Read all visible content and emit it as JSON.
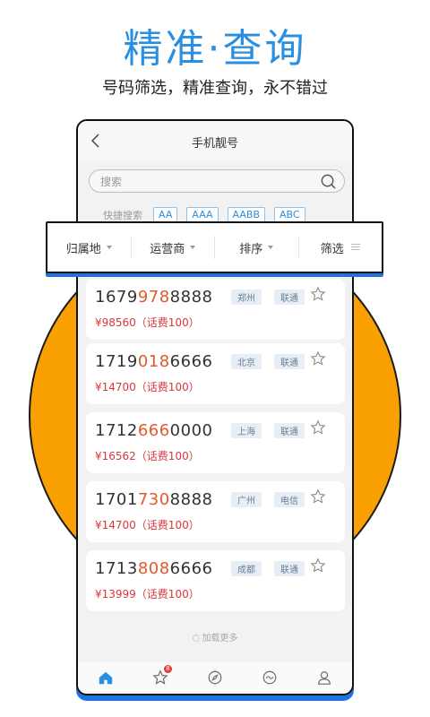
{
  "banner": {
    "headline": "精准·查询",
    "subline": "号码筛选，精准查询，永不错过"
  },
  "app": {
    "title": "手机靓号",
    "search": {
      "placeholder": "搜索"
    },
    "quick_search": {
      "label": "快捷搜索",
      "tags": [
        "AA",
        "AAA",
        "AABB",
        "ABC"
      ]
    },
    "filters": [
      {
        "label": "归属地"
      },
      {
        "label": "运营商"
      },
      {
        "label": "排序"
      },
      {
        "label": "筛选"
      }
    ],
    "numbers": [
      {
        "prefix": "1679",
        "highlight": "978",
        "suffix": "8888",
        "price": "¥98560（话费100）",
        "city": "郑州",
        "operator": "联通"
      },
      {
        "prefix": "1719",
        "highlight": "018",
        "suffix": "6666",
        "price": "¥14700（话费100）",
        "city": "北京",
        "operator": "联通"
      },
      {
        "prefix": "1712",
        "highlight": "666",
        "suffix": "0000",
        "price": "¥16562（话费100）",
        "city": "上海",
        "operator": "联通"
      },
      {
        "prefix": "1701",
        "highlight": "730",
        "suffix": "8888",
        "price": "¥14700（话费100）",
        "city": "广州",
        "operator": "电信"
      },
      {
        "prefix": "1713",
        "highlight": "808",
        "suffix": "6666",
        "price": "¥13999（话费100）",
        "city": "成都",
        "operator": "联通"
      }
    ],
    "load_more": "加载更多",
    "tabs": [
      {
        "icon": "home-icon",
        "active": true
      },
      {
        "icon": "star-icon",
        "badge": "8"
      },
      {
        "icon": "compass-icon"
      },
      {
        "icon": "discover-icon"
      },
      {
        "icon": "user-icon"
      }
    ]
  },
  "colors": {
    "accent": "#2a8fe0",
    "circle": "#f8a100",
    "frame_shadow": "#1d73e0",
    "highlight": "#e05a2b",
    "price": "#d9363e"
  }
}
